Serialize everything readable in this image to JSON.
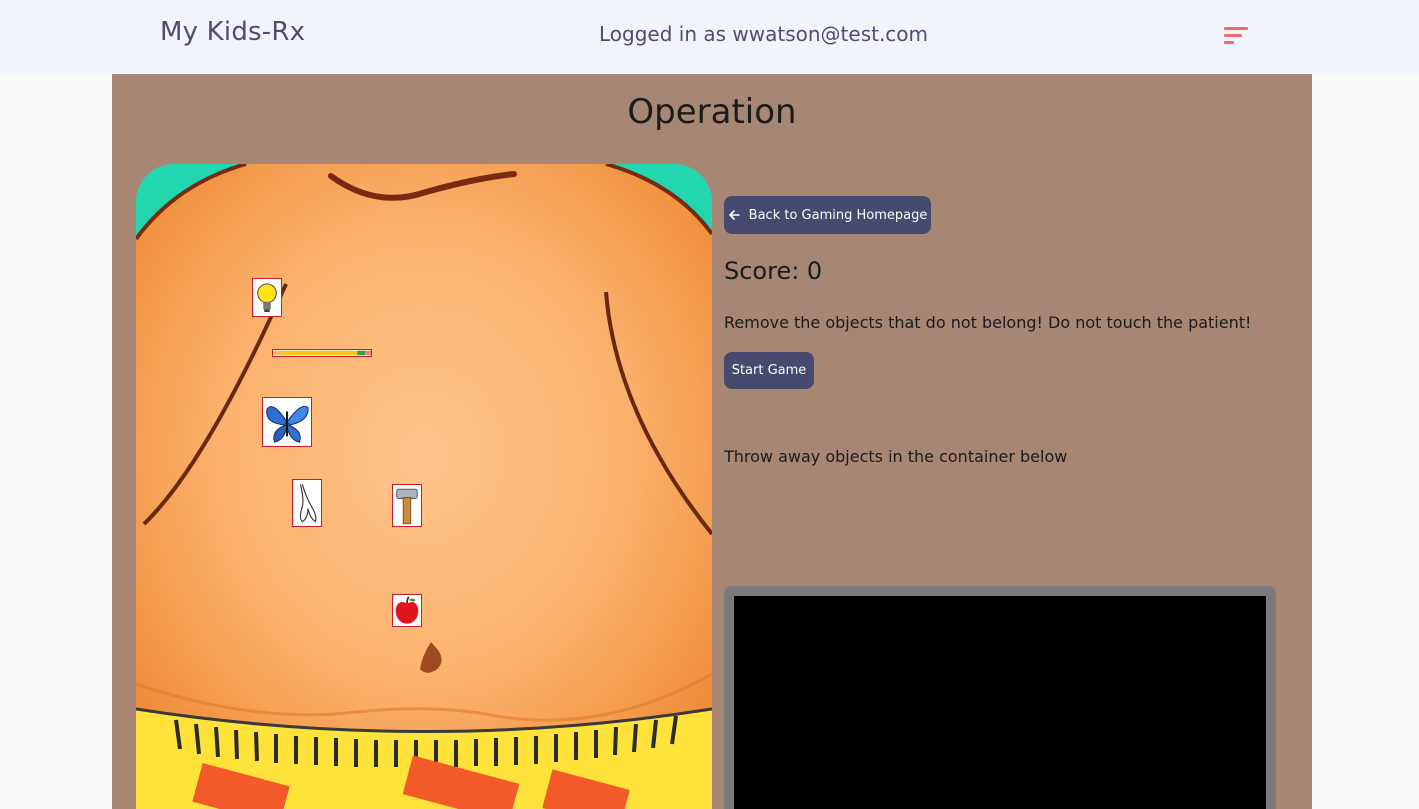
{
  "header": {
    "brand": "My Kids-Rx",
    "user_text": "Logged in as wwatson@test.com",
    "menu_icon": "menu-icon",
    "menu_color": "#f06a6a"
  },
  "game": {
    "title": "Operation",
    "back_label": "Back to Gaming Homepage",
    "back_icon": "arrow-left-icon",
    "score_label": "Score: 0",
    "score": 0,
    "instruction": "Remove the objects that do not belong! Do not touch the patient!",
    "start_label": "Start Game",
    "throw_text": "Throw away objects in the container below"
  },
  "objects": [
    "lightbulb",
    "pencil",
    "butterfly",
    "wishbone",
    "hammer",
    "apple"
  ],
  "colors": {
    "panel": "#a88674",
    "button": "#454a6e",
    "skin": "#f6a55c",
    "board_corner": "#22d6b0",
    "trash_frame": "#7b7b7b"
  }
}
